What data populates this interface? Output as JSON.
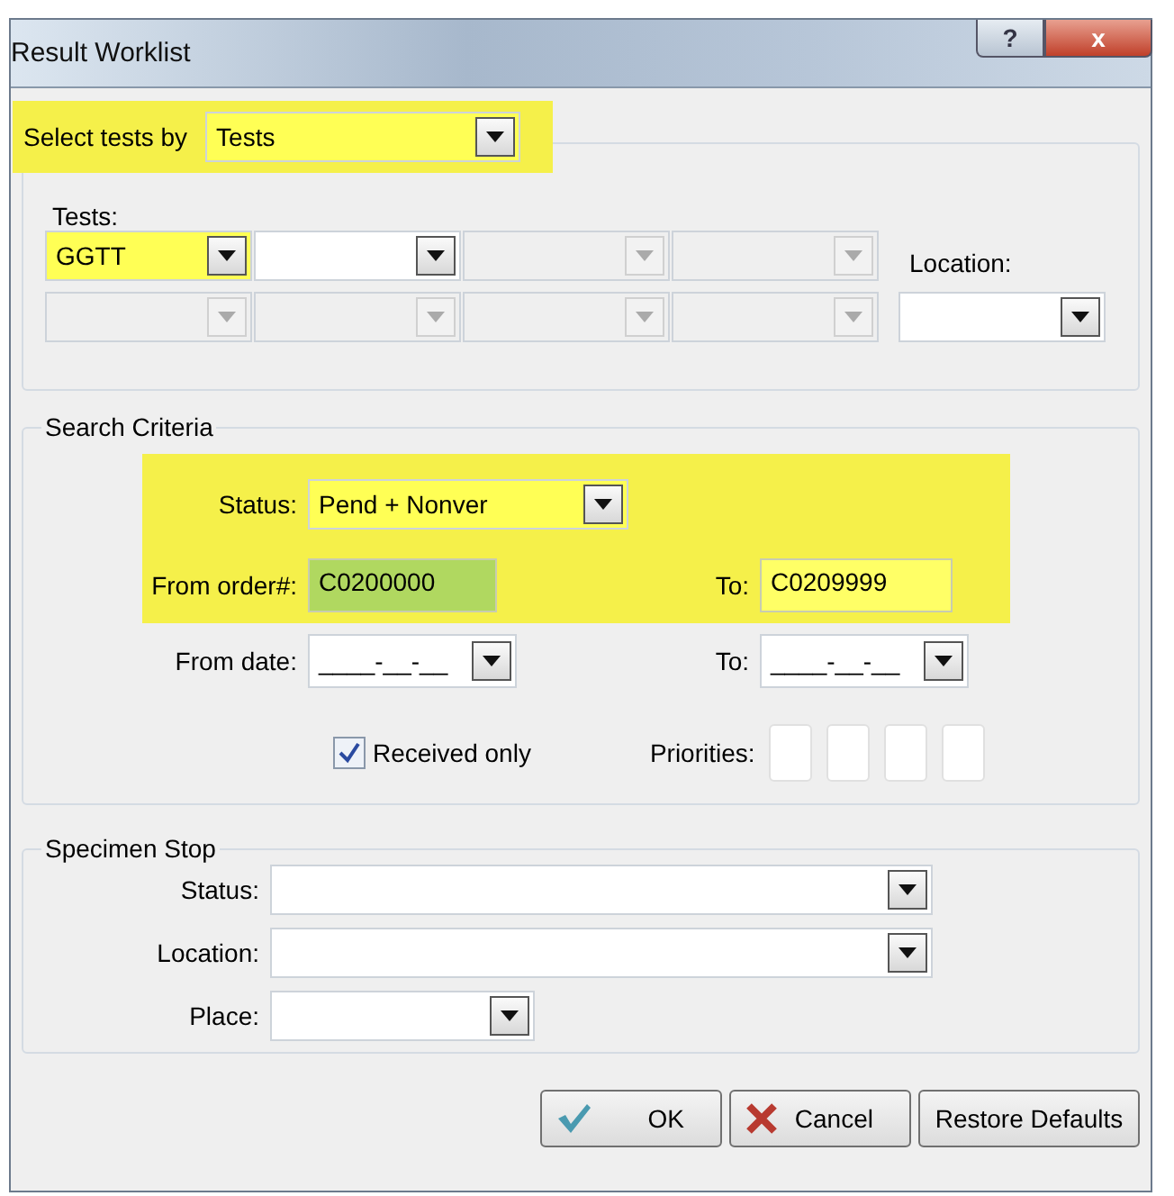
{
  "window": {
    "title": "Result Worklist",
    "buttons": [
      "?",
      "x"
    ]
  },
  "select_by": {
    "label": "Select tests by",
    "value": "Tests",
    "highlighted": true
  },
  "tests": {
    "label": "Tests:",
    "combos": [
      {
        "value": "GGTT",
        "disabled": false,
        "highlighted": true
      },
      {
        "disabled": false,
        "highlighted": false
      },
      {
        "disabled": true,
        "highlighted": false
      },
      {
        "disabled": true,
        "highlighted": false
      },
      {
        "disabled": true,
        "highlighted": false
      },
      {
        "disabled": true,
        "highlighted": false
      },
      {
        "disabled": true,
        "highlighted": false
      },
      {
        "disabled": true,
        "highlighted": false
      }
    ],
    "location": {
      "label": "Location:"
    }
  },
  "search_criteria": {
    "title": "Search Criteria",
    "status": {
      "label": "Status:",
      "value": "Pend + Nonver",
      "highlighted": true
    },
    "from_order": {
      "label": "From order#:",
      "value": "C0200000",
      "color": "#b0d860"
    },
    "to_order": {
      "label": "To:",
      "value": "C0209999",
      "color": "#ffff66"
    },
    "from_date": {
      "label": "From date:",
      "value": "____-__-__"
    },
    "to_date": {
      "label": "To:",
      "value": "____-__-__"
    },
    "received_only": {
      "label": "Received only",
      "checked": true
    },
    "priorities": {
      "label": "Priorities:"
    }
  },
  "specimen_stop": {
    "title": "Specimen Stop",
    "fields": [
      {
        "label": "Status:",
        "wide": true
      },
      {
        "label": "Location:",
        "wide": true
      },
      {
        "label": "Place:",
        "wide": false
      }
    ]
  },
  "buttons": [
    {
      "kind": "ok",
      "label": "OK"
    },
    {
      "kind": "cancel",
      "label": "Cancel"
    },
    {
      "kind": "plain",
      "label": "Restore Defaults"
    }
  ]
}
